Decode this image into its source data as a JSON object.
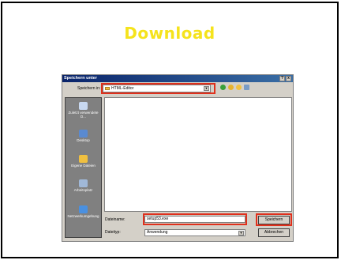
{
  "slide": {
    "title": "Download"
  },
  "dialog": {
    "title": "Speichern unter",
    "title_buttons": [
      "?",
      "x"
    ],
    "save_in_label": "Speichern in:",
    "folder": "HTML-Editor",
    "places": [
      {
        "label": "Zuletzt verwendete D...",
        "icon": "recent-documents-icon"
      },
      {
        "label": "Desktop",
        "icon": "desktop-icon"
      },
      {
        "label": "Eigene Dateien",
        "icon": "my-documents-icon"
      },
      {
        "label": "Arbeitsplatz",
        "icon": "my-computer-icon"
      },
      {
        "label": "Netzwerkumgebung",
        "icon": "network-places-icon"
      }
    ],
    "filename_label": "Dateiname:",
    "filename_value": "setup53.exe",
    "filetype_label": "Dateityp:",
    "filetype_value": "Anwendung",
    "save_button": "Speichern",
    "cancel_button": "Abbrechen"
  },
  "colors": {
    "title": "#f5e31c",
    "highlight": "#e0301c",
    "titlebar": "#0a246a"
  }
}
